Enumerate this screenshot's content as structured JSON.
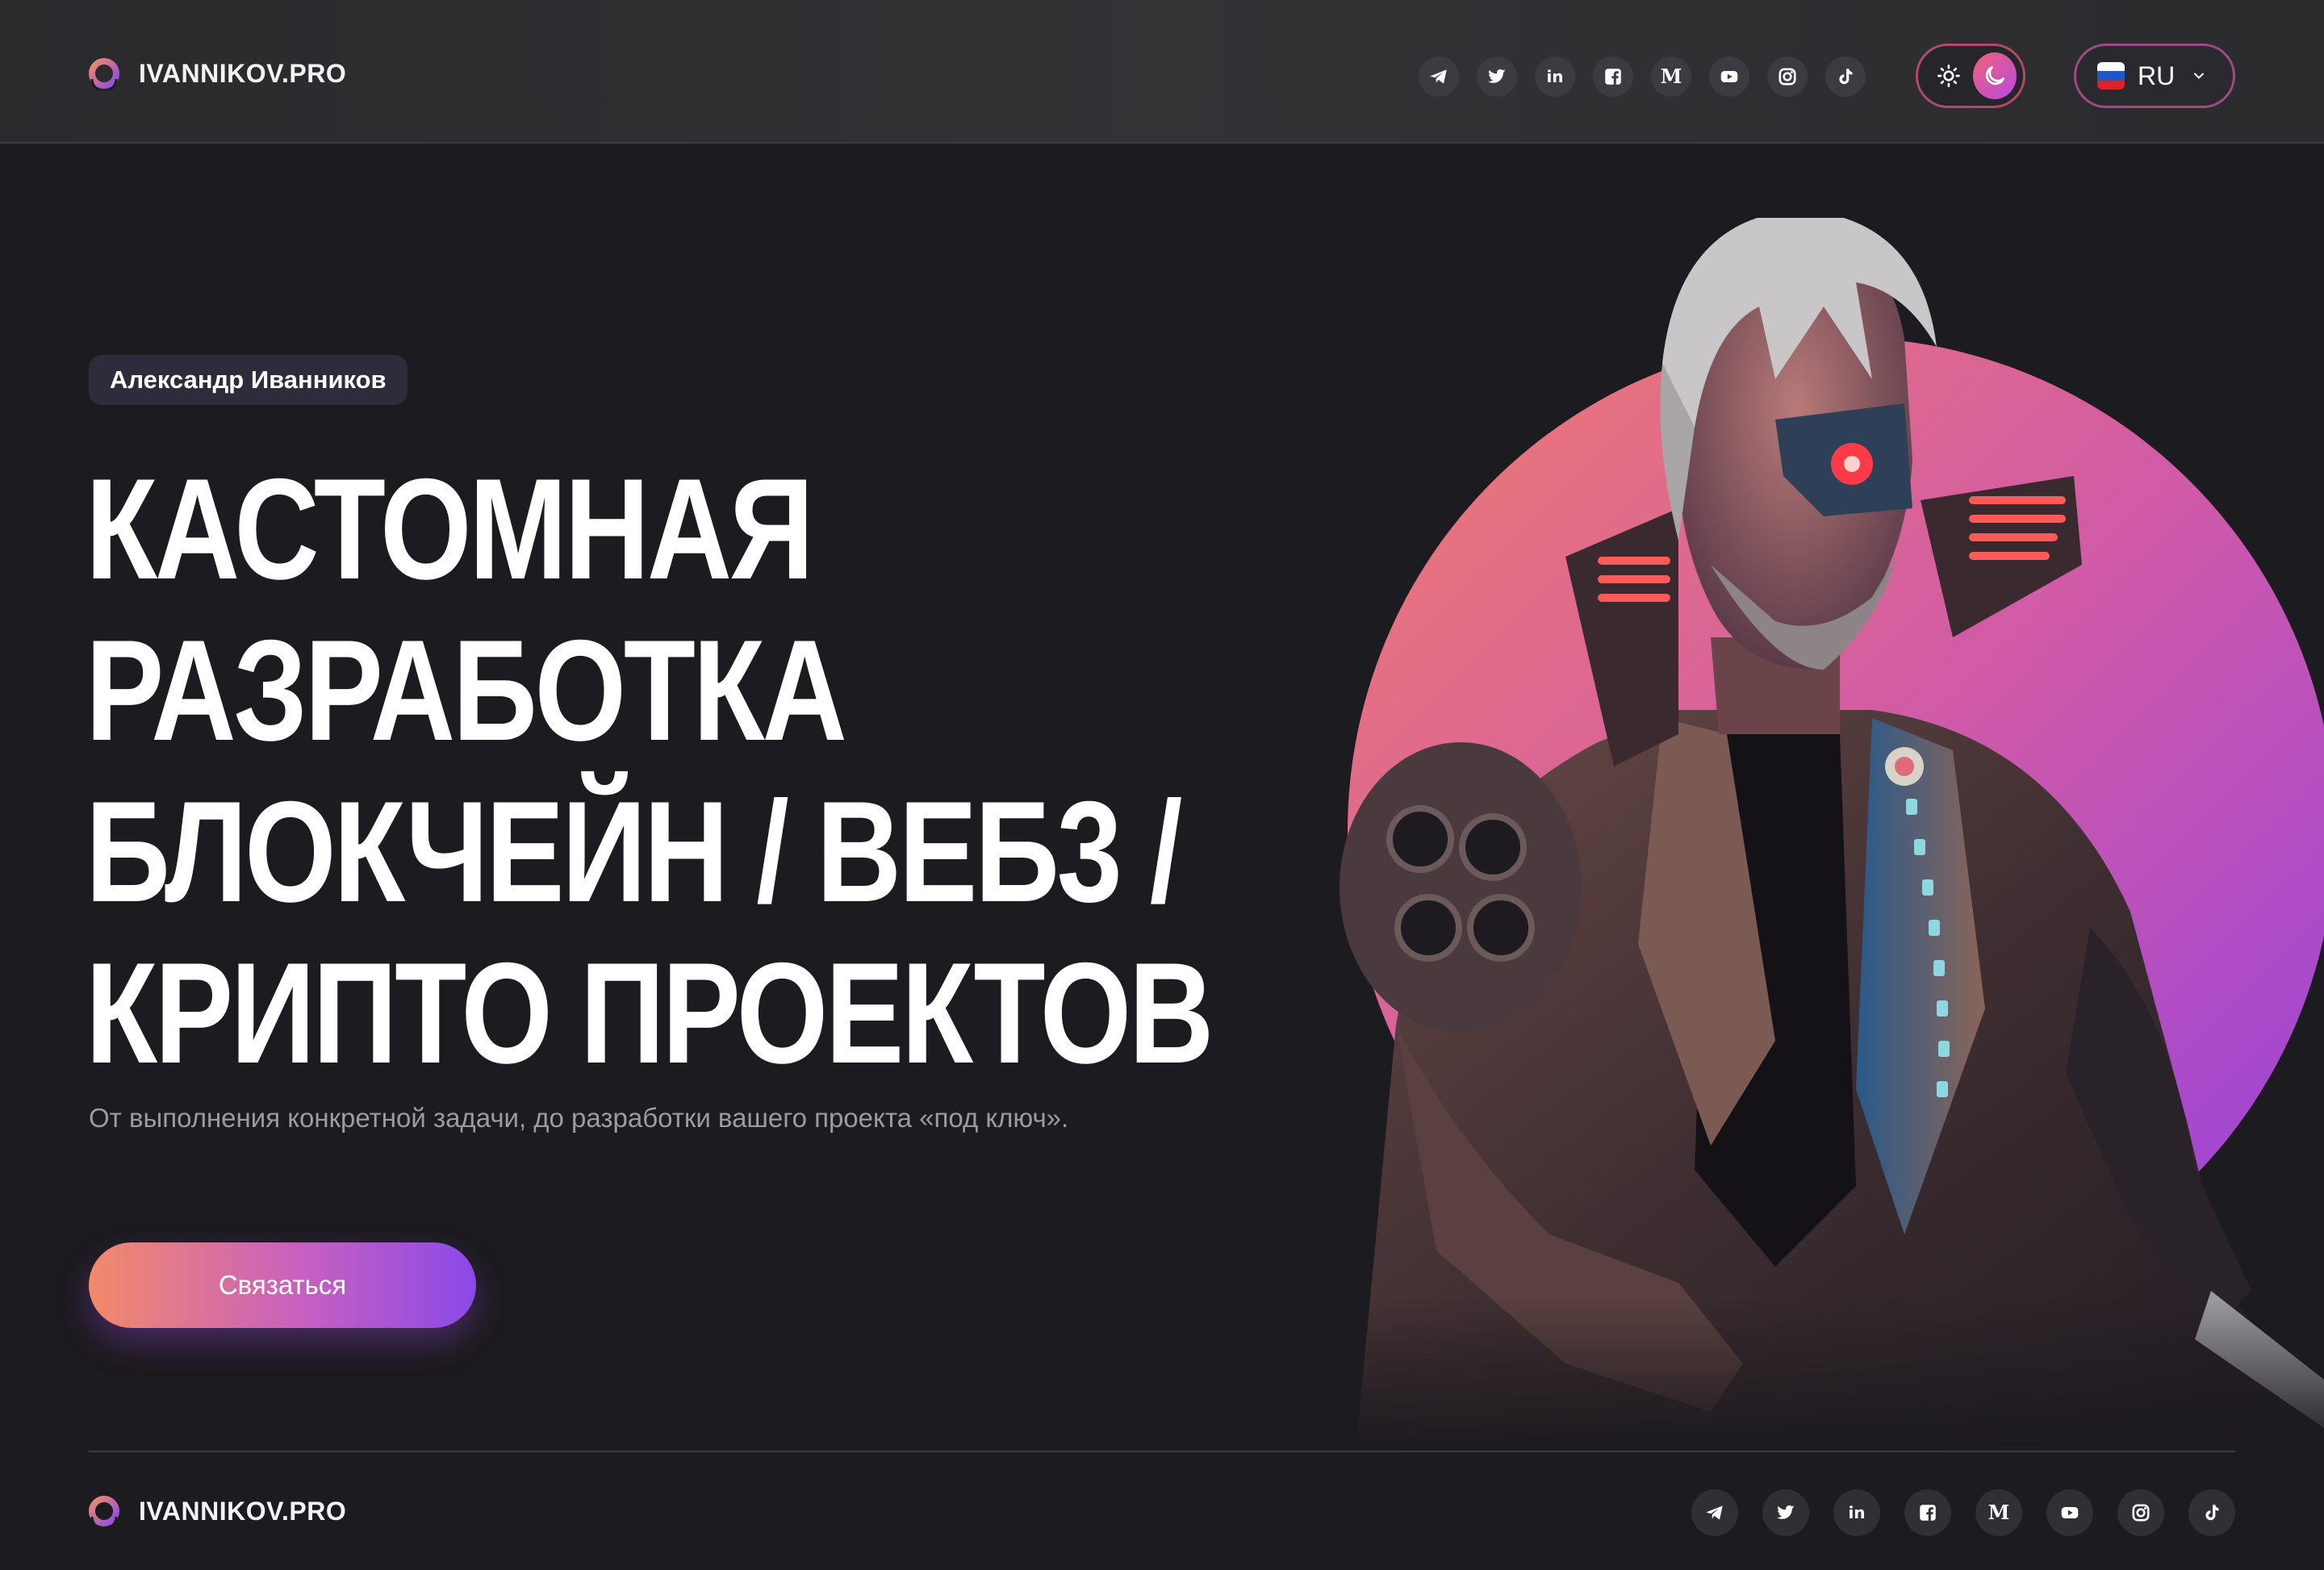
{
  "header": {
    "brand": "IVANNIKOV.PRO",
    "socials": [
      {
        "name": "telegram-icon"
      },
      {
        "name": "twitter-icon"
      },
      {
        "name": "linkedin-icon",
        "glyph": "in"
      },
      {
        "name": "facebook-icon"
      },
      {
        "name": "medium-icon",
        "glyph": "M"
      },
      {
        "name": "youtube-icon"
      },
      {
        "name": "instagram-icon"
      },
      {
        "name": "tiktok-icon"
      }
    ],
    "theme_toggle": {
      "left_icon": "sun-icon",
      "right_icon": "moon-icon",
      "active": "dark"
    },
    "language": {
      "value": "RU",
      "flag": "russia-flag-icon"
    }
  },
  "hero": {
    "badge": "Александр Иванников",
    "title_lines": [
      "КАСТОМНАЯ",
      "РАЗРАБОТКА",
      "БЛОКЧЕЙН / ВЕБ3 /",
      "КРИПТО ПРОЕКТОВ"
    ],
    "subtitle": "От выполнения конкретной задачи, до разработки вашего проекта «под ключ».",
    "cta": "Связаться"
  },
  "footer": {
    "brand": "IVANNIKOV.PRO",
    "social_glyphs": {
      "linkedin": "in",
      "medium": "M"
    }
  },
  "colors": {
    "background": "#1c1b1f",
    "accent_start": "#f28a6a",
    "accent_end": "#8a4ae8"
  }
}
